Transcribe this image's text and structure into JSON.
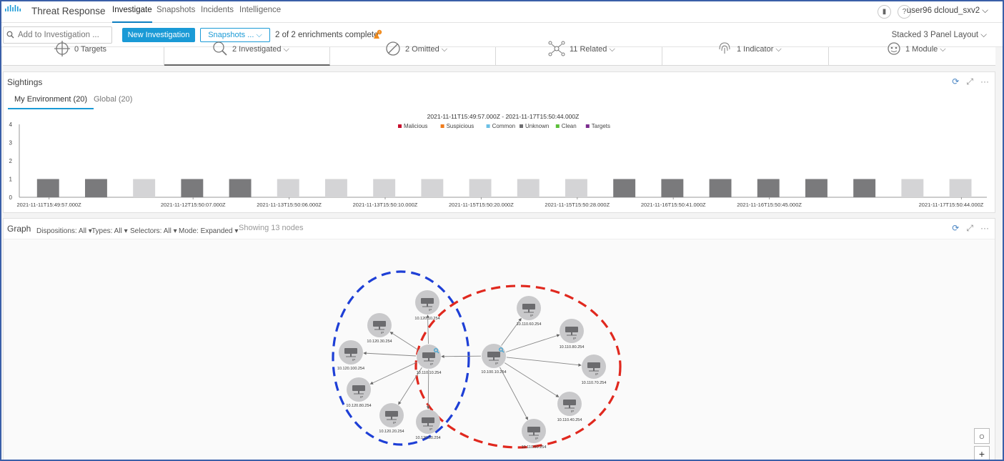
{
  "app": {
    "brand": "Threat Response",
    "nav": [
      "Investigate",
      "Snapshots",
      "Incidents",
      "Intelligence"
    ],
    "active_nav": "Investigate",
    "user": "user96 dcloud_sxv2 ⌵"
  },
  "toolbar": {
    "add_placeholder": "Add to Investigation ...",
    "new_investigation": "New Investigation",
    "snapshots": "Snapshots ... ⌵",
    "enrichments": "2 of 2 enrichments complete",
    "layout": "Stacked 3 Panel Layout ⌵"
  },
  "summary": [
    {
      "label": "0 Targets",
      "icon": "target-icon"
    },
    {
      "label": "2 Investigated ⌵",
      "icon": "search-icon"
    },
    {
      "label": "2 Omitted ⌵",
      "icon": "ban-icon"
    },
    {
      "label": "11 Related ⌵",
      "icon": "network-icon"
    },
    {
      "label": "1 Indicator ⌵",
      "icon": "fingerprint-icon"
    },
    {
      "label": "1 Module ⌵",
      "icon": "module-icon"
    }
  ],
  "sightings": {
    "title": "Sightings",
    "tabs": [
      "My Environment (20)",
      "Global (20)"
    ],
    "active_tab": "My Environment (20)"
  },
  "chart_data": {
    "type": "bar",
    "title": "2021-11-11T15:49:57.000Z - 2021-11-17T15:50:44.000Z",
    "legend": [
      {
        "name": "Malicious",
        "color": "#c8102e"
      },
      {
        "name": "Suspicious",
        "color": "#f07c1b"
      },
      {
        "name": "Common",
        "color": "#6cc0e5"
      },
      {
        "name": "Unknown",
        "color": "#6e6e70"
      },
      {
        "name": "Clean",
        "color": "#5cbf3a"
      },
      {
        "name": "Targets",
        "color": "#7b2d8e"
      }
    ],
    "legend_position": "top-center",
    "yticks": [
      "0",
      "1",
      "2",
      "3",
      "4"
    ],
    "ylim": [
      0,
      4
    ],
    "values": [
      1,
      1,
      1,
      1,
      1,
      1,
      1,
      1,
      1,
      1,
      1,
      1,
      1,
      1,
      1,
      1,
      1,
      1,
      1,
      1
    ],
    "bar_color_keys": [
      "dark",
      "dark",
      "light",
      "dark",
      "dark",
      "light",
      "light",
      "light",
      "light",
      "light",
      "light",
      "light",
      "dark",
      "dark",
      "dark",
      "dark",
      "dark",
      "dark",
      "light",
      "light"
    ],
    "bar_colors": {
      "dark": "#7a7a7c",
      "light": "#d4d4d6"
    },
    "xticks": [
      {
        "index": 0.5,
        "label": "2021-11-11T15:49:57.000Z"
      },
      {
        "index": 3.5,
        "label": "2021-11-12T15:50:07.000Z"
      },
      {
        "index": 5.5,
        "label": "2021-11-13T15:50:06.000Z"
      },
      {
        "index": 7.5,
        "label": "2021-11-13T15:50:10.000Z"
      },
      {
        "index": 9.5,
        "label": "2021-11-15T15:50:20.000Z"
      },
      {
        "index": 11.5,
        "label": "2021-11-15T15:50:28.000Z"
      },
      {
        "index": 13.5,
        "label": "2021-11-16T15:50:41.000Z"
      },
      {
        "index": 15.5,
        "label": "2021-11-16T15:50:45.000Z"
      },
      {
        "index": 19.5,
        "label": "2021-11-17T15:50:44.000Z"
      }
    ]
  },
  "graph": {
    "title": "Graph",
    "filters": [
      "Dispositions: All ▾",
      "Types: All ▾",
      "Selectors: All ▾",
      "Mode: Expanded ▾"
    ],
    "count": "Showing 13 nodes",
    "nodes": [
      {
        "id": "10.120.10.254",
        "label": "10.120.10.254"
      },
      {
        "id": "10.120.30.254",
        "label": "10.120.30.254"
      },
      {
        "id": "10.120.100.254",
        "label": "10.120.100.254"
      },
      {
        "id": "10.120.80.254",
        "label": "10.120.80.254"
      },
      {
        "id": "10.120.20.254",
        "label": "10.120.20.254"
      },
      {
        "id": "10.120.50.254",
        "label": "10.120.50.254"
      },
      {
        "id": "10.110.10.254",
        "label": "10.110.10.254"
      },
      {
        "id": "10.100.10.254",
        "label": "10.100.10.254"
      },
      {
        "id": "10.110.60.254",
        "label": "10.110.60.254"
      },
      {
        "id": "10.110.80.254",
        "label": "10.110.80.254"
      },
      {
        "id": "10.110.70.254",
        "label": "10.110.70.254"
      },
      {
        "id": "10.110.40.254",
        "label": "10.110.40.254"
      },
      {
        "id": "10.110.50.254",
        "label": "10.110.50.254"
      }
    ],
    "edges": [
      [
        "10.110.10.254",
        "10.120.10.254"
      ],
      [
        "10.110.10.254",
        "10.120.30.254"
      ],
      [
        "10.110.10.254",
        "10.120.100.254"
      ],
      [
        "10.110.10.254",
        "10.120.80.254"
      ],
      [
        "10.110.10.254",
        "10.120.20.254"
      ],
      [
        "10.110.10.254",
        "10.120.50.254"
      ],
      [
        "10.100.10.254",
        "10.110.10.254"
      ],
      [
        "10.100.10.254",
        "10.110.60.254"
      ],
      [
        "10.100.10.254",
        "10.110.80.254"
      ],
      [
        "10.100.10.254",
        "10.110.70.254"
      ],
      [
        "10.100.10.254",
        "10.110.40.254"
      ],
      [
        "10.100.10.254",
        "10.110.50.254"
      ]
    ],
    "investigated_nodes": [
      "10.110.10.254",
      "10.100.10.254"
    ],
    "zoom": [
      "○",
      "+"
    ]
  },
  "colors": {
    "accent": "#1a9ad6",
    "cluster_left": "#1e3fd6",
    "cluster_right": "#e0281e",
    "warning": "#f08a1c"
  }
}
